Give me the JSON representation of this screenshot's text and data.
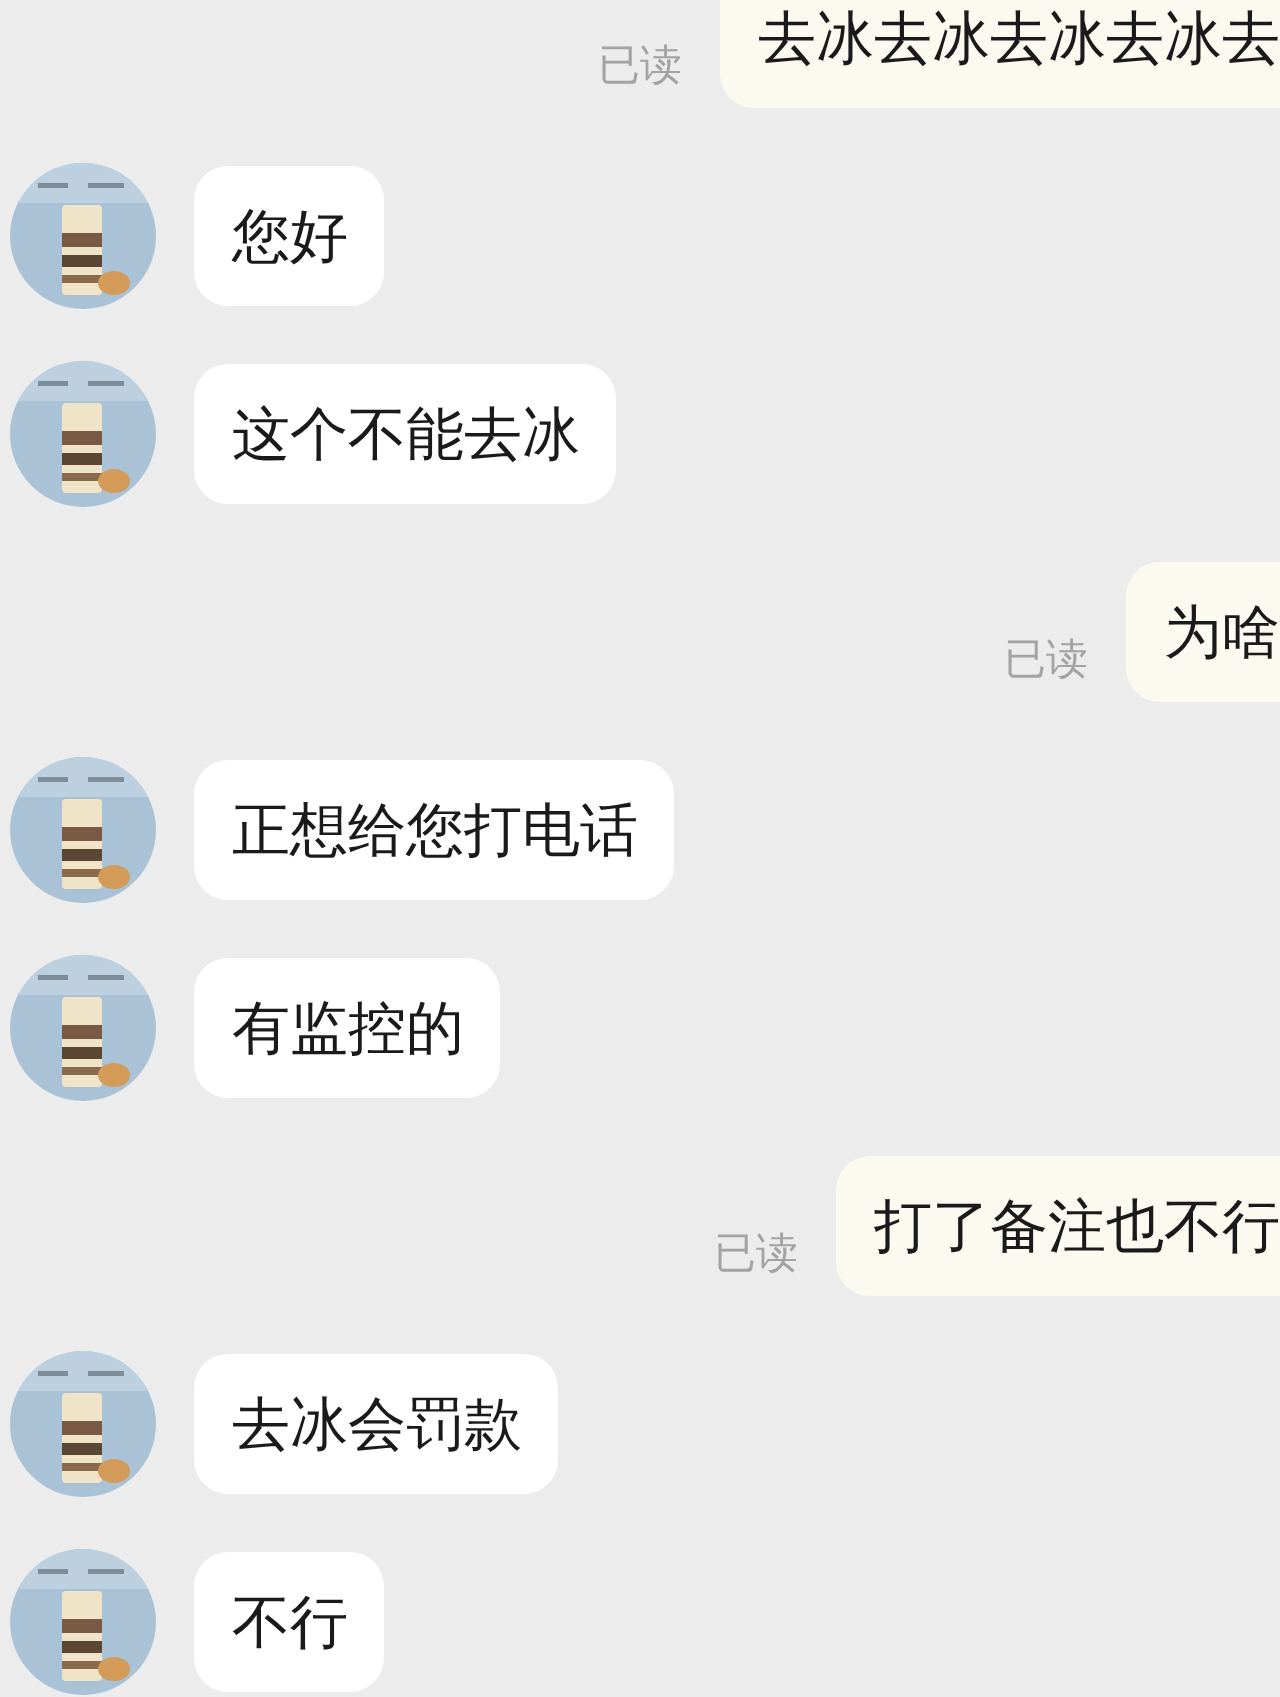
{
  "messages": [
    {
      "kind": "outgoing",
      "text": "去冰去冰去冰去冰去",
      "receipt": "已读"
    },
    {
      "kind": "incoming",
      "text": "您好"
    },
    {
      "kind": "incoming",
      "text": "这个不能去冰"
    },
    {
      "kind": "outgoing",
      "text": "为啥",
      "receipt": "已读"
    },
    {
      "kind": "incoming",
      "text": "正想给您打电话"
    },
    {
      "kind": "incoming",
      "text": "有监控的"
    },
    {
      "kind": "outgoing",
      "text": "打了备注也不行",
      "receipt": "已读"
    },
    {
      "kind": "incoming",
      "text": "去冰会罚款"
    },
    {
      "kind": "incoming",
      "text": "不行"
    }
  ]
}
